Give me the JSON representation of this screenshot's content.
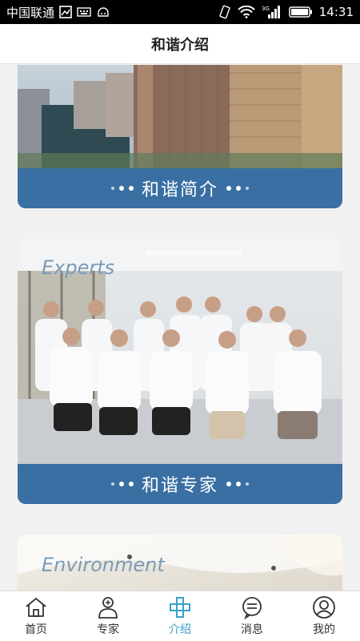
{
  "status_bar": {
    "carrier": "中国联通",
    "time": "14:31",
    "network": "3G"
  },
  "header": {
    "title": "和谐介绍"
  },
  "cards": [
    {
      "label": "和谐简介",
      "overlay": ""
    },
    {
      "label": "和谐专家",
      "overlay": "Experts"
    },
    {
      "label": "",
      "overlay": "Environment"
    }
  ],
  "tabs": [
    {
      "label": "首页",
      "icon": "home-icon"
    },
    {
      "label": "专家",
      "icon": "doctor-icon"
    },
    {
      "label": "介绍",
      "icon": "cross-icon"
    },
    {
      "label": "消息",
      "icon": "message-icon"
    },
    {
      "label": "我的",
      "icon": "user-icon"
    }
  ],
  "colors": {
    "accent": "#39a0c8",
    "band": "#3a6fa3"
  }
}
